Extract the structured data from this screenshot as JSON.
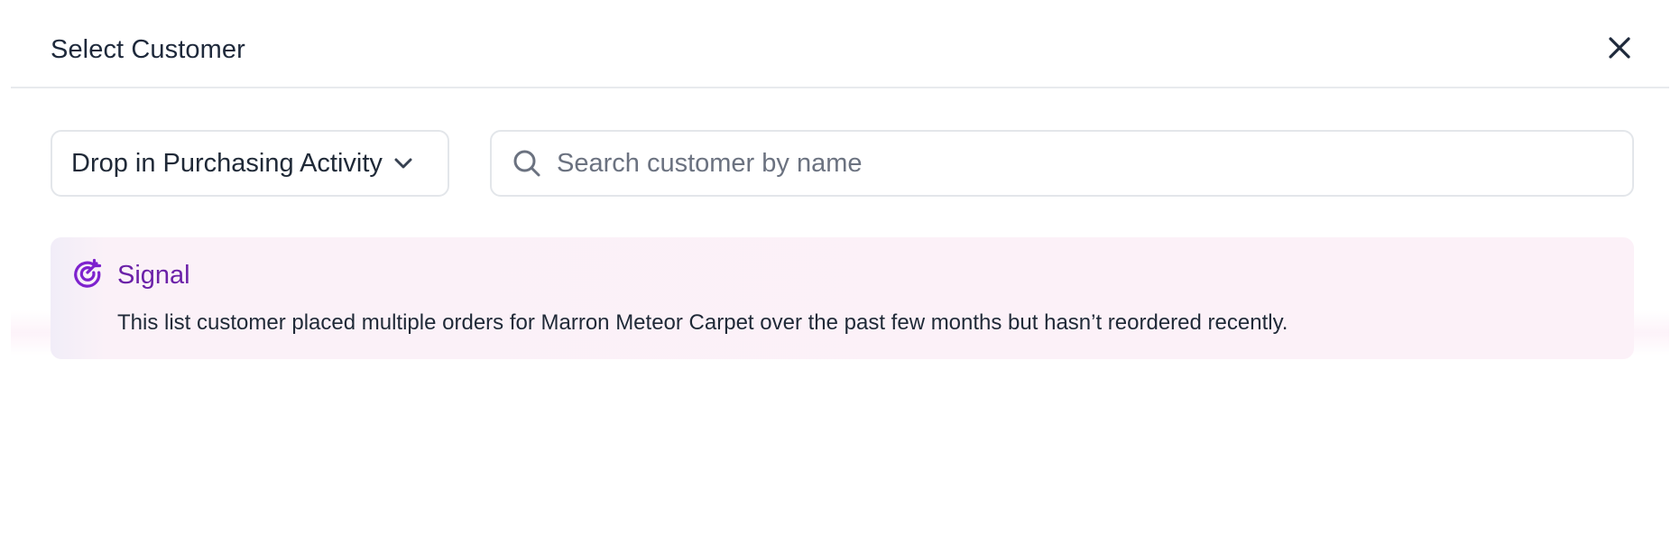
{
  "dialog": {
    "title": "Select Customer",
    "close_icon": "close-icon"
  },
  "filter": {
    "selected": "Drop in Purchasing Activity",
    "icon": "chevron-down-icon"
  },
  "search": {
    "placeholder": "Search customer by name",
    "value": "",
    "icon": "search-icon"
  },
  "signal": {
    "icon": "target-arrow-icon",
    "title": "Signal",
    "description": "This list customer placed multiple orders for Marron Meteor Carpet over the past few months but hasn’t reordered recently."
  },
  "colors": {
    "accent_purple": "#6b21a8",
    "signal_background": "#fcf1f8",
    "border": "#e3e6ea",
    "text": "#1f2937"
  }
}
